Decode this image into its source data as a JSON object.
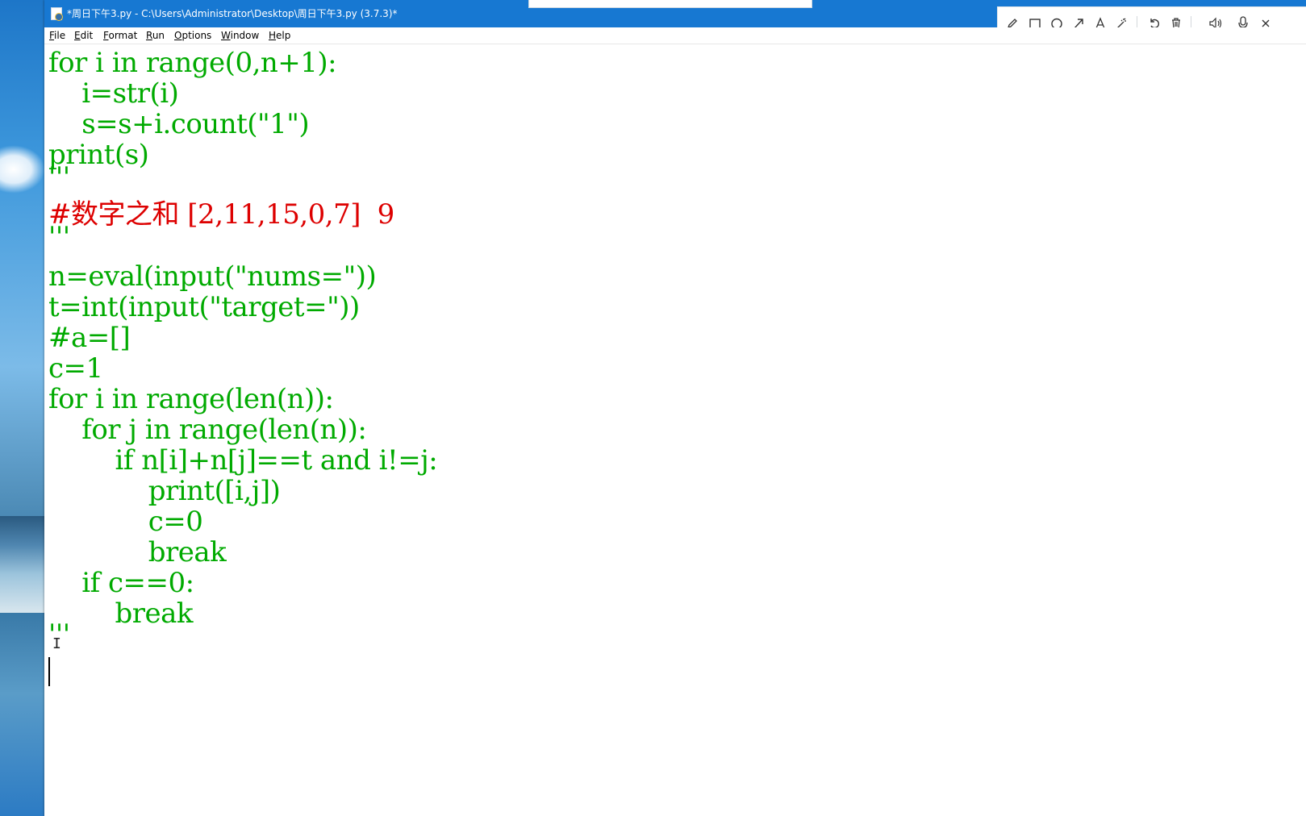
{
  "window": {
    "title": "*周日下午3.py - C:\\Users\\Administrator\\Desktop\\周日下午3.py (3.7.3)*"
  },
  "menu": {
    "file": "File",
    "edit": "Edit",
    "format": "Format",
    "run": "Run",
    "options": "Options",
    "window": "Window",
    "help": "Help"
  },
  "annotation_toolbar": {
    "icons": [
      "pencil-icon",
      "rectangle-icon",
      "circle-icon",
      "arrow-icon",
      "text-icon",
      "magic-wand-icon",
      "undo-icon",
      "trash-icon",
      "speaker-icon",
      "microphone-icon"
    ]
  },
  "editor": {
    "lines": [
      {
        "text": "for i in range(0,n+1):",
        "kind": "string"
      },
      {
        "text": "    i=str(i)",
        "kind": "string"
      },
      {
        "text": "    s=s+i.count(\"1\")",
        "kind": "string"
      },
      {
        "text": "print(s)",
        "kind": "string"
      },
      {
        "text": "'''",
        "kind": "string"
      },
      {
        "text": "#数字之和 [2,11,15,0,7]  9",
        "kind": "comment"
      },
      {
        "text": "'''",
        "kind": "string"
      },
      {
        "text": "n=eval(input(\"nums=\"))",
        "kind": "string"
      },
      {
        "text": "t=int(input(\"target=\"))",
        "kind": "string"
      },
      {
        "text": "#a=[]",
        "kind": "string"
      },
      {
        "text": "c=1",
        "kind": "string"
      },
      {
        "text": "for i in range(len(n)):",
        "kind": "string"
      },
      {
        "text": "    for j in range(len(n)):",
        "kind": "string"
      },
      {
        "text": "        if n[i]+n[j]==t and i!=j:",
        "kind": "string"
      },
      {
        "text": "            print([i,j])",
        "kind": "string"
      },
      {
        "text": "            c=0",
        "kind": "string"
      },
      {
        "text": "            break",
        "kind": "string"
      },
      {
        "text": "    if c==0:",
        "kind": "string"
      },
      {
        "text": "        break",
        "kind": "string"
      },
      {
        "text": "'''",
        "kind": "string"
      }
    ]
  },
  "colors": {
    "string": "#00aa00",
    "comment": "#dd0000",
    "titlebar": "#1778d2"
  }
}
